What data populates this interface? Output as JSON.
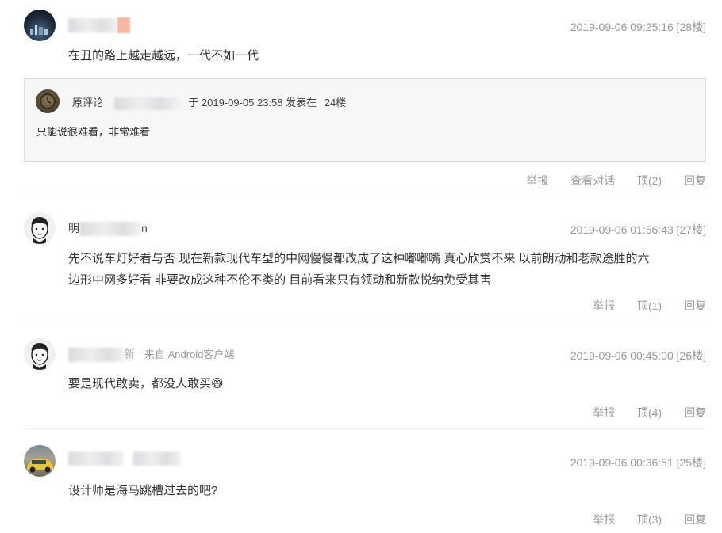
{
  "comments": [
    {
      "user": "",
      "time": "2019-09-06 09:25:16",
      "floor": "[28楼]",
      "text": "在丑的路上越走越远，一代不如一代",
      "quote": {
        "label": "原评论",
        "user": "",
        "time_prefix": "于 2019-09-05 23:58 发表在",
        "floor": "24楼",
        "text": "只能说很难看，非常难看"
      },
      "actions": [
        "举报",
        "查看对话",
        "顶(2)",
        "回复"
      ]
    },
    {
      "user_prefix": "明",
      "user_suffix": "n",
      "time": "2019-09-06 01:56:43",
      "floor": "[27楼]",
      "text_line1": "先不说车灯好看与否 现在新款现代车型的中网慢慢都改成了这种嘟嘟嘴 真心欣赏不来 以前朗动和老款途胜的六",
      "text_line2": "边形中网多好看 非要改成这种不伦不类的 目前看来只有领动和新款悦纳免受其害",
      "actions": [
        "举报",
        "顶(1)",
        "回复"
      ]
    },
    {
      "user_suffix": "新",
      "source": "来自 Android客户端",
      "time": "2019-09-06 00:45:00",
      "floor": "[26楼]",
      "text": "要是现代敢卖，都没人敢买",
      "emoji": "😅",
      "actions": [
        "举报",
        "顶(4)",
        "回复"
      ]
    },
    {
      "user": "",
      "time": "2019-09-06 00:36:51",
      "floor": "[25楼]",
      "text": "设计师是海马跳槽过去的吧?",
      "actions": [
        "举报",
        "顶(3)",
        "回复"
      ]
    }
  ]
}
